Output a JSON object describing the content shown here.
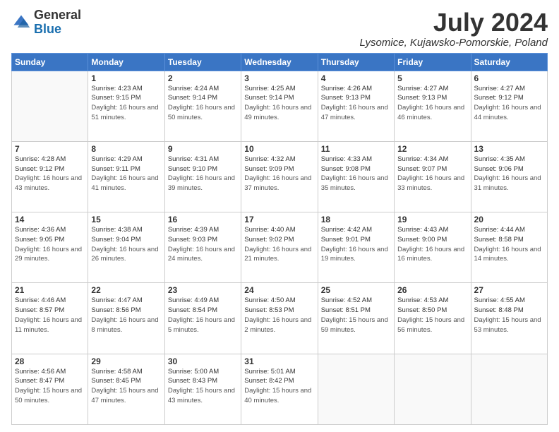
{
  "logo": {
    "general": "General",
    "blue": "Blue"
  },
  "title": "July 2024",
  "location": "Lysomice, Kujawsko-Pomorskie, Poland",
  "days_of_week": [
    "Sunday",
    "Monday",
    "Tuesday",
    "Wednesday",
    "Thursday",
    "Friday",
    "Saturday"
  ],
  "weeks": [
    [
      {
        "num": "",
        "sunrise": "",
        "sunset": "",
        "daylight": ""
      },
      {
        "num": "1",
        "sunrise": "Sunrise: 4:23 AM",
        "sunset": "Sunset: 9:15 PM",
        "daylight": "Daylight: 16 hours and 51 minutes."
      },
      {
        "num": "2",
        "sunrise": "Sunrise: 4:24 AM",
        "sunset": "Sunset: 9:14 PM",
        "daylight": "Daylight: 16 hours and 50 minutes."
      },
      {
        "num": "3",
        "sunrise": "Sunrise: 4:25 AM",
        "sunset": "Sunset: 9:14 PM",
        "daylight": "Daylight: 16 hours and 49 minutes."
      },
      {
        "num": "4",
        "sunrise": "Sunrise: 4:26 AM",
        "sunset": "Sunset: 9:13 PM",
        "daylight": "Daylight: 16 hours and 47 minutes."
      },
      {
        "num": "5",
        "sunrise": "Sunrise: 4:27 AM",
        "sunset": "Sunset: 9:13 PM",
        "daylight": "Daylight: 16 hours and 46 minutes."
      },
      {
        "num": "6",
        "sunrise": "Sunrise: 4:27 AM",
        "sunset": "Sunset: 9:12 PM",
        "daylight": "Daylight: 16 hours and 44 minutes."
      }
    ],
    [
      {
        "num": "7",
        "sunrise": "Sunrise: 4:28 AM",
        "sunset": "Sunset: 9:12 PM",
        "daylight": "Daylight: 16 hours and 43 minutes."
      },
      {
        "num": "8",
        "sunrise": "Sunrise: 4:29 AM",
        "sunset": "Sunset: 9:11 PM",
        "daylight": "Daylight: 16 hours and 41 minutes."
      },
      {
        "num": "9",
        "sunrise": "Sunrise: 4:31 AM",
        "sunset": "Sunset: 9:10 PM",
        "daylight": "Daylight: 16 hours and 39 minutes."
      },
      {
        "num": "10",
        "sunrise": "Sunrise: 4:32 AM",
        "sunset": "Sunset: 9:09 PM",
        "daylight": "Daylight: 16 hours and 37 minutes."
      },
      {
        "num": "11",
        "sunrise": "Sunrise: 4:33 AM",
        "sunset": "Sunset: 9:08 PM",
        "daylight": "Daylight: 16 hours and 35 minutes."
      },
      {
        "num": "12",
        "sunrise": "Sunrise: 4:34 AM",
        "sunset": "Sunset: 9:07 PM",
        "daylight": "Daylight: 16 hours and 33 minutes."
      },
      {
        "num": "13",
        "sunrise": "Sunrise: 4:35 AM",
        "sunset": "Sunset: 9:06 PM",
        "daylight": "Daylight: 16 hours and 31 minutes."
      }
    ],
    [
      {
        "num": "14",
        "sunrise": "Sunrise: 4:36 AM",
        "sunset": "Sunset: 9:05 PM",
        "daylight": "Daylight: 16 hours and 29 minutes."
      },
      {
        "num": "15",
        "sunrise": "Sunrise: 4:38 AM",
        "sunset": "Sunset: 9:04 PM",
        "daylight": "Daylight: 16 hours and 26 minutes."
      },
      {
        "num": "16",
        "sunrise": "Sunrise: 4:39 AM",
        "sunset": "Sunset: 9:03 PM",
        "daylight": "Daylight: 16 hours and 24 minutes."
      },
      {
        "num": "17",
        "sunrise": "Sunrise: 4:40 AM",
        "sunset": "Sunset: 9:02 PM",
        "daylight": "Daylight: 16 hours and 21 minutes."
      },
      {
        "num": "18",
        "sunrise": "Sunrise: 4:42 AM",
        "sunset": "Sunset: 9:01 PM",
        "daylight": "Daylight: 16 hours and 19 minutes."
      },
      {
        "num": "19",
        "sunrise": "Sunrise: 4:43 AM",
        "sunset": "Sunset: 9:00 PM",
        "daylight": "Daylight: 16 hours and 16 minutes."
      },
      {
        "num": "20",
        "sunrise": "Sunrise: 4:44 AM",
        "sunset": "Sunset: 8:58 PM",
        "daylight": "Daylight: 16 hours and 14 minutes."
      }
    ],
    [
      {
        "num": "21",
        "sunrise": "Sunrise: 4:46 AM",
        "sunset": "Sunset: 8:57 PM",
        "daylight": "Daylight: 16 hours and 11 minutes."
      },
      {
        "num": "22",
        "sunrise": "Sunrise: 4:47 AM",
        "sunset": "Sunset: 8:56 PM",
        "daylight": "Daylight: 16 hours and 8 minutes."
      },
      {
        "num": "23",
        "sunrise": "Sunrise: 4:49 AM",
        "sunset": "Sunset: 8:54 PM",
        "daylight": "Daylight: 16 hours and 5 minutes."
      },
      {
        "num": "24",
        "sunrise": "Sunrise: 4:50 AM",
        "sunset": "Sunset: 8:53 PM",
        "daylight": "Daylight: 16 hours and 2 minutes."
      },
      {
        "num": "25",
        "sunrise": "Sunrise: 4:52 AM",
        "sunset": "Sunset: 8:51 PM",
        "daylight": "Daylight: 15 hours and 59 minutes."
      },
      {
        "num": "26",
        "sunrise": "Sunrise: 4:53 AM",
        "sunset": "Sunset: 8:50 PM",
        "daylight": "Daylight: 15 hours and 56 minutes."
      },
      {
        "num": "27",
        "sunrise": "Sunrise: 4:55 AM",
        "sunset": "Sunset: 8:48 PM",
        "daylight": "Daylight: 15 hours and 53 minutes."
      }
    ],
    [
      {
        "num": "28",
        "sunrise": "Sunrise: 4:56 AM",
        "sunset": "Sunset: 8:47 PM",
        "daylight": "Daylight: 15 hours and 50 minutes."
      },
      {
        "num": "29",
        "sunrise": "Sunrise: 4:58 AM",
        "sunset": "Sunset: 8:45 PM",
        "daylight": "Daylight: 15 hours and 47 minutes."
      },
      {
        "num": "30",
        "sunrise": "Sunrise: 5:00 AM",
        "sunset": "Sunset: 8:43 PM",
        "daylight": "Daylight: 15 hours and 43 minutes."
      },
      {
        "num": "31",
        "sunrise": "Sunrise: 5:01 AM",
        "sunset": "Sunset: 8:42 PM",
        "daylight": "Daylight: 15 hours and 40 minutes."
      },
      {
        "num": "",
        "sunrise": "",
        "sunset": "",
        "daylight": ""
      },
      {
        "num": "",
        "sunrise": "",
        "sunset": "",
        "daylight": ""
      },
      {
        "num": "",
        "sunrise": "",
        "sunset": "",
        "daylight": ""
      }
    ]
  ]
}
